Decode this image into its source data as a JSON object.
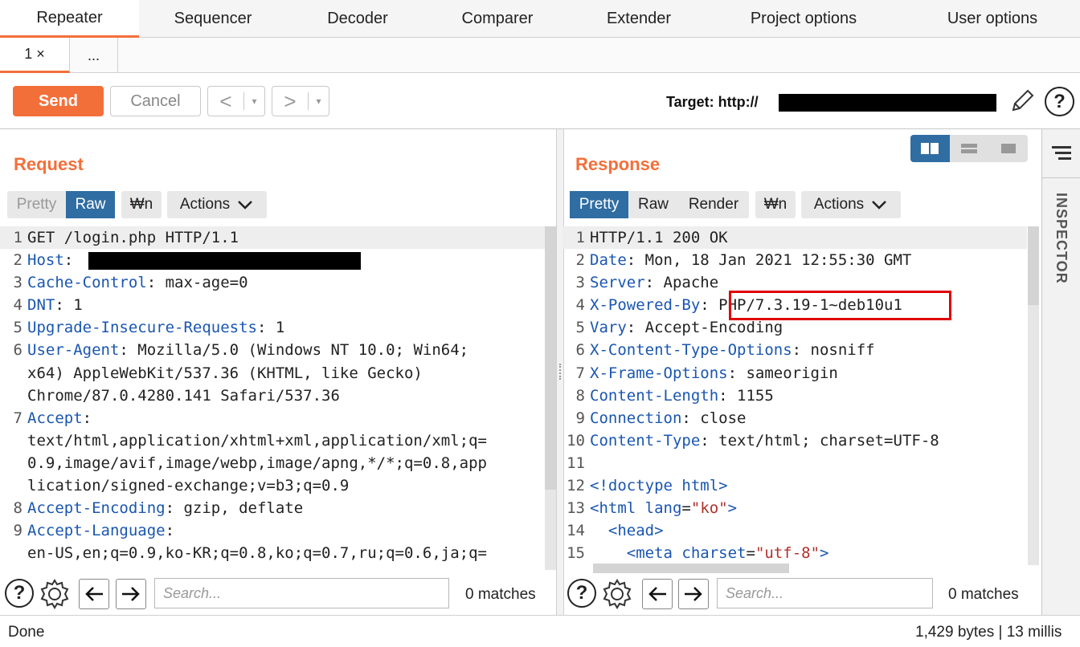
{
  "top_tabs": [
    "Repeater",
    "Sequencer",
    "Decoder",
    "Comparer",
    "Extender",
    "Project options",
    "User options"
  ],
  "sub_tabs": {
    "tab1": "1 ×",
    "more": "..."
  },
  "toolbar": {
    "send": "Send",
    "cancel": "Cancel",
    "back": "<",
    "forward": ">",
    "dropdown": "▾",
    "target_label": "Target: http://",
    "help": "?",
    "edit_icon": "pencil-icon"
  },
  "request": {
    "title": "Request",
    "view_tabs": [
      "Pretty",
      "Raw"
    ],
    "wrap_button": "₩n",
    "actions": "Actions",
    "lines": [
      {
        "n": "1",
        "name": "",
        "value": "GET /login.php HTTP/1.1"
      },
      {
        "n": "2",
        "name": "Host",
        "value": ": "
      },
      {
        "n": "3",
        "name": "Cache-Control",
        "value": ": max-age=0"
      },
      {
        "n": "4",
        "name": "DNT",
        "value": ": 1"
      },
      {
        "n": "5",
        "name": "Upgrade-Insecure-Requests",
        "value": ": 1"
      },
      {
        "n": "6",
        "name": "User-Agent",
        "value": ": Mozilla/5.0 (Windows NT 10.0; Win64;"
      },
      {
        "n": "",
        "name": "",
        "value": "x64) AppleWebKit/537.36 (KHTML, like Gecko)"
      },
      {
        "n": "",
        "name": "",
        "value": "Chrome/87.0.4280.141 Safari/537.36"
      },
      {
        "n": "7",
        "name": "Accept",
        "value": ":"
      },
      {
        "n": "",
        "name": "",
        "value": "text/html,application/xhtml+xml,application/xml;q="
      },
      {
        "n": "",
        "name": "",
        "value": "0.9,image/avif,image/webp,image/apng,*/*;q=0.8,app"
      },
      {
        "n": "",
        "name": "",
        "value": "lication/signed-exchange;v=b3;q=0.9"
      },
      {
        "n": "8",
        "name": "Accept-Encoding",
        "value": ": gzip, deflate"
      },
      {
        "n": "9",
        "name": "Accept-Language",
        "value": ":"
      },
      {
        "n": "",
        "name": "",
        "value": "en-US,en;q=0.9,ko-KR;q=0.8,ko;q=0.7,ru;q=0.6,ja;q="
      }
    ],
    "search_placeholder": "Search...",
    "matches": "0 matches"
  },
  "response": {
    "title": "Response",
    "view_tabs": [
      "Pretty",
      "Raw",
      "Render"
    ],
    "wrap_button": "₩n",
    "actions": "Actions",
    "lines": [
      {
        "n": "1",
        "name": "",
        "value": "HTTP/1.1 200 OK"
      },
      {
        "n": "2",
        "name": "Date",
        "value": ": Mon, 18 Jan 2021 12:55:30 GMT"
      },
      {
        "n": "3",
        "name": "Server",
        "value": ": Apache"
      },
      {
        "n": "4",
        "name": "X-Powered-By",
        "value": ": PHP/7.3.19-1~deb10u1"
      },
      {
        "n": "5",
        "name": "Vary",
        "value": ": Accept-Encoding"
      },
      {
        "n": "6",
        "name": "X-Content-Type-Options",
        "value": ": nosniff"
      },
      {
        "n": "7",
        "name": "X-Frame-Options",
        "value": ": sameorigin"
      },
      {
        "n": "8",
        "name": "Content-Length",
        "value": ": 1155"
      },
      {
        "n": "9",
        "name": "Connection",
        "value": ": close"
      },
      {
        "n": "10",
        "name": "Content-Type",
        "value": ": text/html; charset=UTF-8"
      },
      {
        "n": "11",
        "name": "",
        "value": ""
      },
      {
        "n": "12",
        "html": "<span class=\"tag\">&lt;!doctype html&gt;</span>"
      },
      {
        "n": "13",
        "html": "<span class=\"tag\">&lt;html</span> <span class=\"attr\">lang</span>=<span class=\"val\">\"ko\"</span><span class=\"tag\">&gt;</span>"
      },
      {
        "n": "14",
        "html": "  <span class=\"tag\">&lt;head&gt;</span>"
      },
      {
        "n": "15",
        "html": "    <span class=\"tag\">&lt;meta</span> <span class=\"attr\">charset</span>=<span class=\"val\">\"utf-8\"</span><span class=\"tag\">&gt;</span>"
      }
    ],
    "search_placeholder": "Search...",
    "matches": "0 matches"
  },
  "inspector": "INSPECTOR",
  "status": {
    "left": "Done",
    "right": "1,429 bytes | 13 millis"
  },
  "colors": {
    "accent": "#f36f3a",
    "selected": "#2f6da3",
    "header_name": "#1a56b0",
    "highlight_box": "#e00000"
  }
}
